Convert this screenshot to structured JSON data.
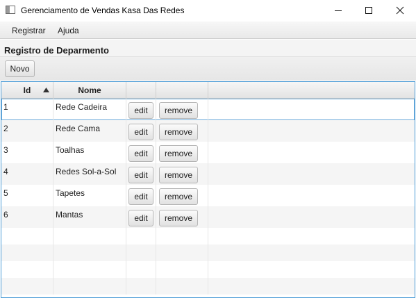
{
  "window": {
    "title": "Gerenciamento de Vendas Kasa Das Redes"
  },
  "menu": {
    "items": [
      "Registrar",
      "Ajuda"
    ]
  },
  "page": {
    "title": "Registro de Deparmento",
    "new_button": "Novo"
  },
  "table": {
    "columns": [
      "Id",
      "Nome",
      "",
      ""
    ],
    "sort": "ascending",
    "rows": [
      {
        "id": "1",
        "nome": "Rede Cadeira",
        "edit": "edit",
        "remove": "remove"
      },
      {
        "id": "2",
        "nome": "Rede Cama",
        "edit": "edit",
        "remove": "remove"
      },
      {
        "id": "3",
        "nome": "Toalhas",
        "edit": "edit",
        "remove": "remove"
      },
      {
        "id": "4",
        "nome": "Redes Sol-a-Sol",
        "edit": "edit",
        "remove": "remove"
      },
      {
        "id": "5",
        "nome": "Tapetes",
        "edit": "edit",
        "remove": "remove"
      },
      {
        "id": "6",
        "nome": "Mantas",
        "edit": "edit",
        "remove": "remove"
      }
    ]
  },
  "colors": {
    "focus_border": "#4a9bd6",
    "stripe": "#f5f5f5"
  }
}
